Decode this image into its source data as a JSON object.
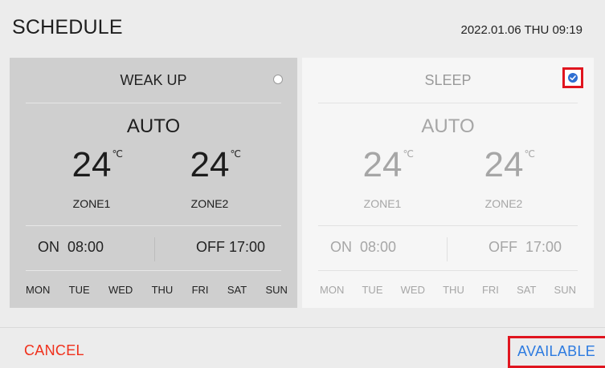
{
  "header": {
    "title": "SCHEDULE",
    "datetime": "2022.01.06 THU 09:19"
  },
  "schedules": [
    {
      "name": "WEAK UP",
      "selected": false,
      "mode": "AUTO",
      "zones": [
        {
          "temp": "24",
          "unit": "℃",
          "label": "ZONE1"
        },
        {
          "temp": "24",
          "unit": "℃",
          "label": "ZONE2"
        }
      ],
      "on_time": "ON  08:00",
      "off_time": "OFF 17:00",
      "days": [
        "MON",
        "TUE",
        "WED",
        "THU",
        "FRI",
        "SAT",
        "SUN"
      ]
    },
    {
      "name": "SLEEP",
      "selected": true,
      "mode": "AUTO",
      "zones": [
        {
          "temp": "24",
          "unit": "℃",
          "label": "ZONE1"
        },
        {
          "temp": "24",
          "unit": "℃",
          "label": "ZONE2"
        }
      ],
      "on_time": "ON  08:00",
      "off_time": "OFF  17:00",
      "days": [
        "MON",
        "TUE",
        "WED",
        "THU",
        "FRI",
        "SAT",
        "SUN"
      ]
    }
  ],
  "footer": {
    "cancel_label": "CANCEL",
    "available_label": "AVAILABLE"
  },
  "icons": {
    "unselected": "radio-empty-icon",
    "selected": "checkmark-circle-icon"
  },
  "colors": {
    "cancel": "#f0301b",
    "available": "#2d7be0",
    "highlight_box": "#e0151f",
    "check": "#2f6fd2",
    "active_card": "#cfcfcf",
    "inactive_card": "#f6f6f6"
  }
}
